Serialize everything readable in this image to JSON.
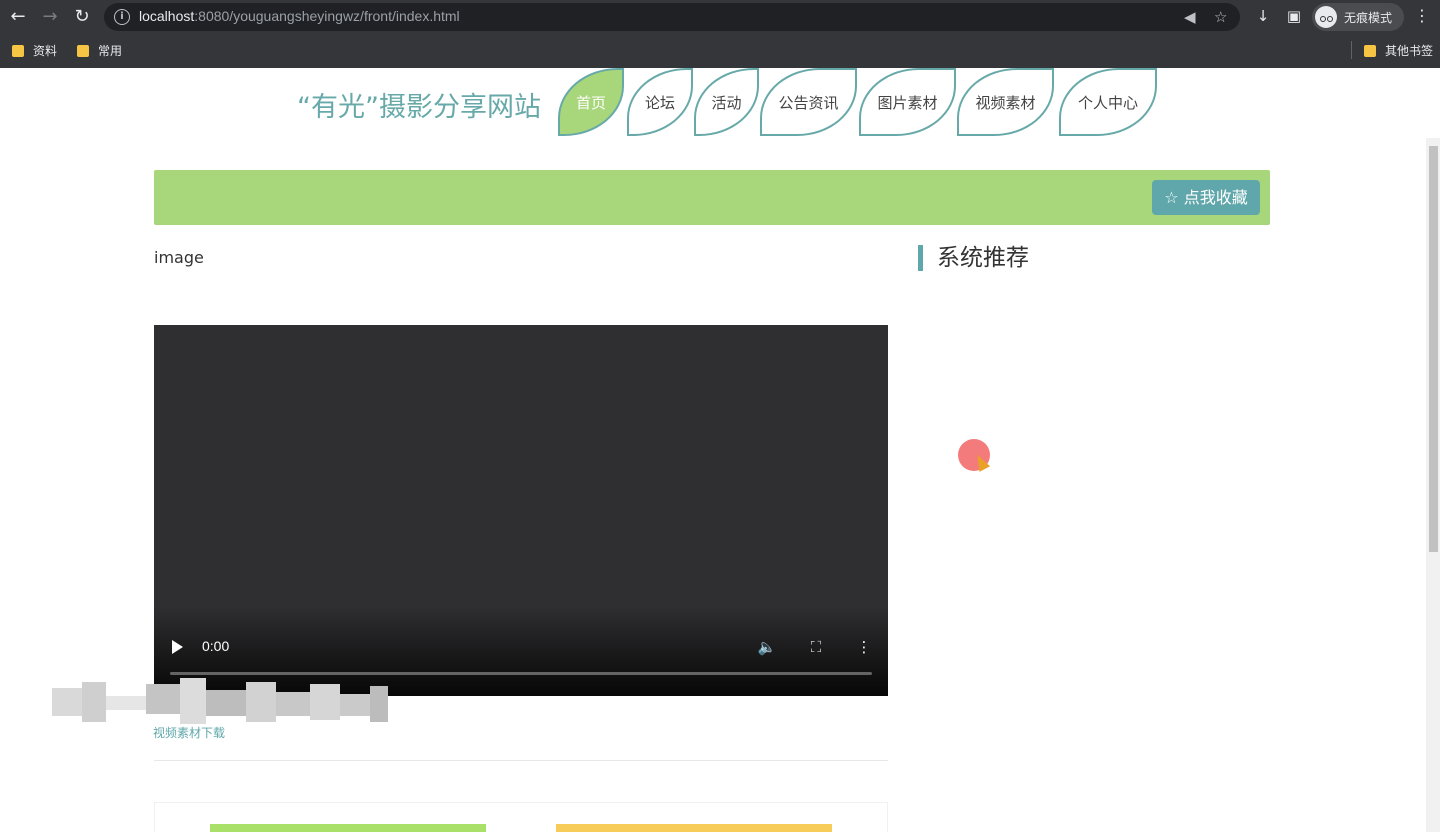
{
  "browser": {
    "url_host": "localhost",
    "url_rest": ":8080/youguangsheyingwz/front/index.html",
    "incognito_label": "无痕模式",
    "bookmarks": [
      {
        "label": "资料"
      },
      {
        "label": "常用"
      }
    ],
    "other_bookmarks": "其他书签"
  },
  "site": {
    "title": "“有光”摄影分享网站",
    "nav": [
      {
        "label": "首页",
        "active": true
      },
      {
        "label": "论坛",
        "active": false
      },
      {
        "label": "活动",
        "active": false
      },
      {
        "label": "公告资讯",
        "active": false
      },
      {
        "label": "图片素材",
        "active": false
      },
      {
        "label": "视频素材",
        "active": false
      },
      {
        "label": "个人中心",
        "active": false
      }
    ],
    "favorite_button": "☆ 点我收藏",
    "image_alt": "image",
    "video": {
      "time": "0:00"
    },
    "download_link": "视频素材下载",
    "sidebar_title": "系统推荐"
  },
  "colors": {
    "accent_teal": "#5fa7aa",
    "accent_green": "#a8d67a",
    "card_yellow": "#f8cc58"
  }
}
